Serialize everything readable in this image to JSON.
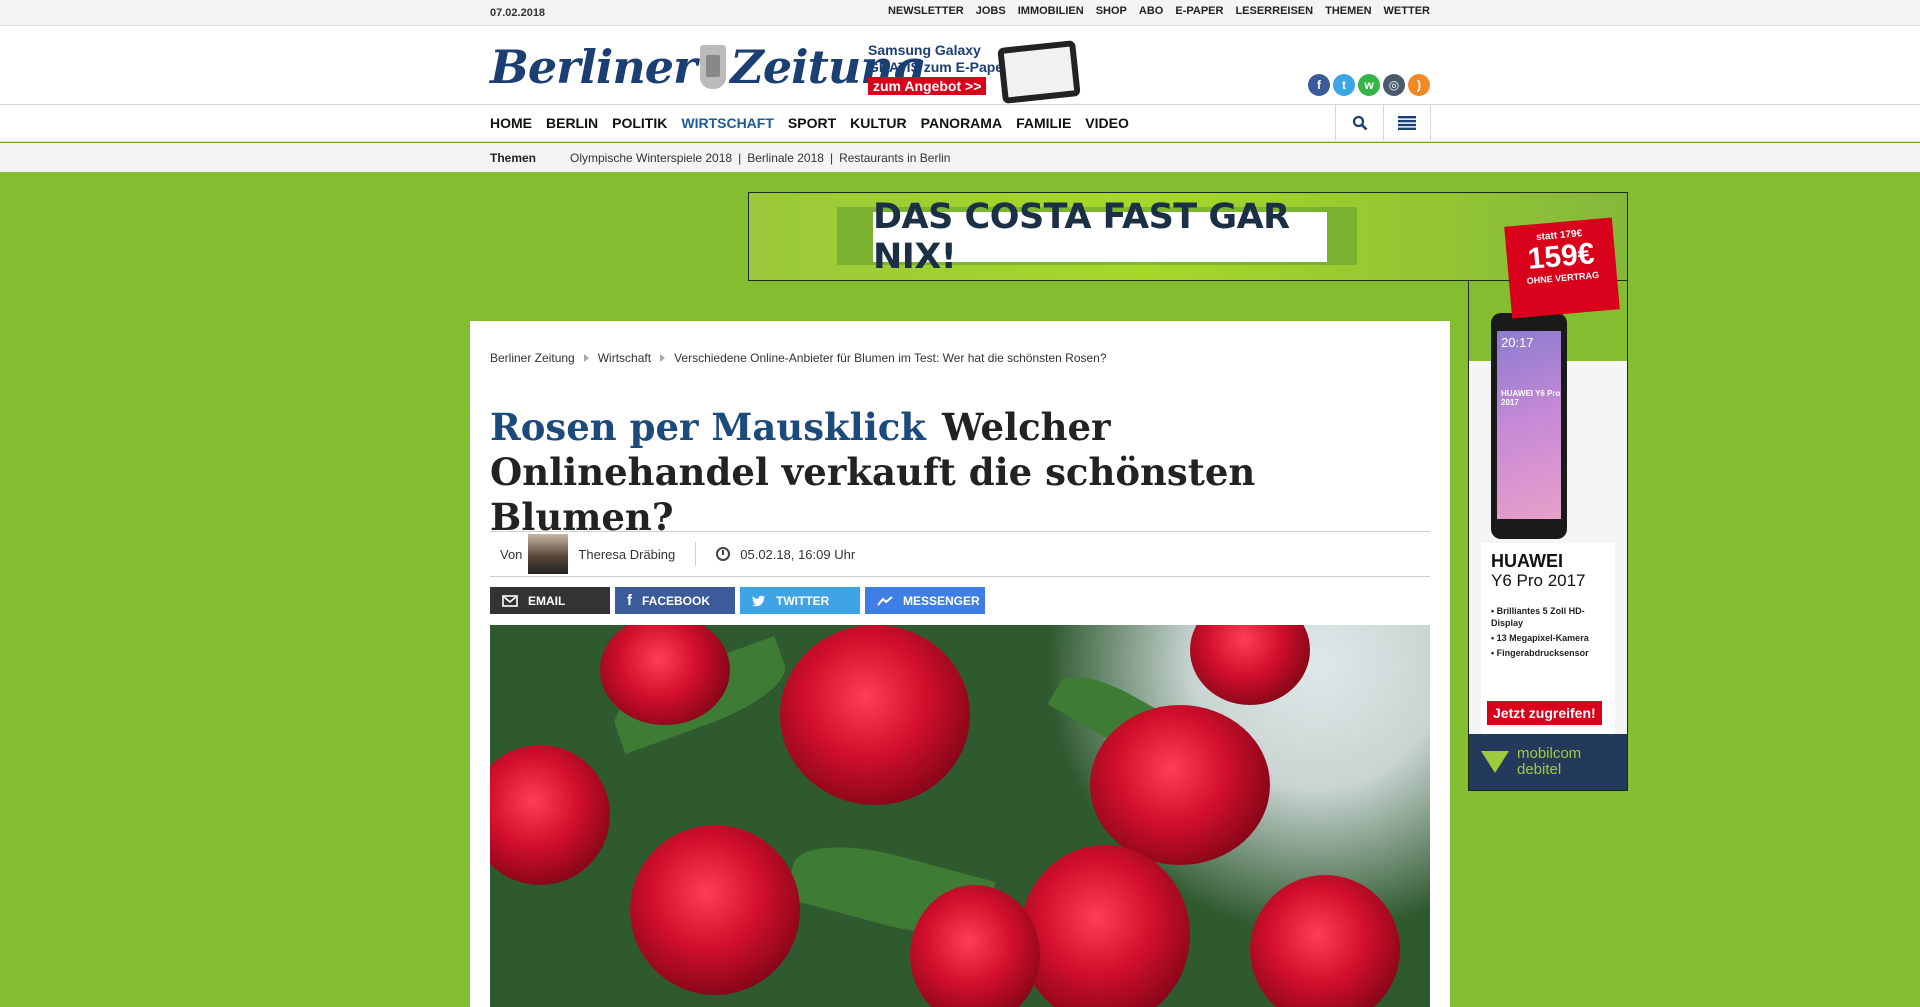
{
  "topbar": {
    "date": "07.02.2018",
    "links": [
      "NEWSLETTER",
      "JOBS",
      "IMMOBILIEN",
      "SHOP",
      "ABO",
      "E-PAPER",
      "LESERREISEN",
      "THEMEN",
      "WETTER"
    ]
  },
  "header": {
    "logo_left": "Berliner",
    "logo_right": "Zeitung",
    "promo": {
      "line1": "Samsung Galaxy",
      "line2": "GRATIS zum E-Paper",
      "cta": "zum Angebot >>"
    },
    "social_icons": [
      "facebook-icon",
      "twitter-icon",
      "whatsapp-icon",
      "instagram-icon",
      "rss-icon"
    ]
  },
  "nav": {
    "items": [
      "HOME",
      "BERLIN",
      "POLITIK",
      "WIRTSCHAFT",
      "SPORT",
      "KULTUR",
      "PANORAMA",
      "FAMILIE",
      "VIDEO"
    ],
    "active": "WIRTSCHAFT",
    "tools": [
      "search-icon",
      "menu-icon"
    ]
  },
  "themen": {
    "label": "Themen",
    "items": [
      "Olympische Winterspiele 2018",
      "Berlinale 2018",
      "Restaurants in Berlin"
    ]
  },
  "ads": {
    "top_banner": "DAS COSTA FAST GAR NIX!",
    "side": {
      "price_old": "statt 179€",
      "price_new": "159€",
      "price_sub": "OHNE VERTRAG",
      "phone_clock": "20:17",
      "phone_brand": "HUAWEI Y6 Pro 2017",
      "product_brand": "HUAWEI",
      "product_model": "Y6 Pro 2017",
      "features": [
        "Brilliantes 5 Zoll HD-Display",
        "13 Megapixel-Kamera",
        "Fingerabdrucksensor"
      ],
      "cta": "Jetzt zugreifen!",
      "footer_line1": "mobilcom",
      "footer_line2": "debitel"
    }
  },
  "article": {
    "breadcrumbs": [
      "Berliner Zeitung",
      "Wirtschaft",
      "Verschiedene Online-Anbieter für Blumen im Test: Wer hat die schönsten Rosen?"
    ],
    "kicker": "Rosen per Mausklick",
    "title": "Welcher Onlinehandel verkauft die schönsten Blumen?",
    "byline_prefix": "Von",
    "author": "Theresa Dräbing",
    "timestamp": "05.02.18, 16:09 Uhr",
    "share": [
      "EMAIL",
      "FACEBOOK",
      "TWITTER",
      "MESSENGER"
    ]
  },
  "colors": {
    "page_background": "#84bd2f",
    "brand_blue": "#1c3f73",
    "nav_active": "#1c5a9c",
    "facebook": "#3b5b9a",
    "twitter": "#3fa4e5",
    "messenger": "#3f7fe5",
    "ad_red": "#d9001b"
  }
}
